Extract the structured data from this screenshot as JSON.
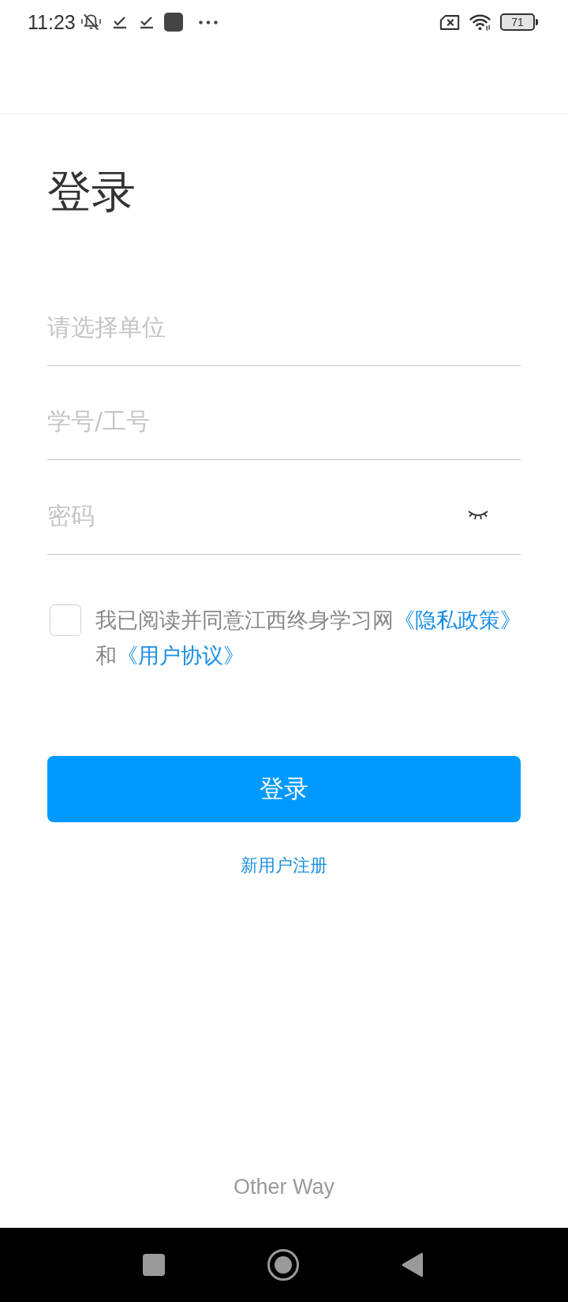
{
  "status_bar": {
    "time": "11:23",
    "battery": "71"
  },
  "title": "登录",
  "fields": [
    {
      "kind": "select",
      "placeholder": "请选择单位"
    },
    {
      "kind": "text",
      "placeholder": "学号/工号"
    },
    {
      "kind": "password",
      "placeholder": "密码",
      "password_visible": false
    }
  ],
  "agreement": {
    "checked": false,
    "parts": [
      {
        "kind": "text",
        "text": "我已阅读并同意江西终身学习网"
      },
      {
        "kind": "link",
        "text": "《隐私政策》"
      },
      {
        "kind": "text",
        "text": "和"
      },
      {
        "kind": "link",
        "text": "《用户协议》"
      }
    ]
  },
  "login_button": "登录",
  "register_link": "新用户注册",
  "other_way": "Other Way"
}
